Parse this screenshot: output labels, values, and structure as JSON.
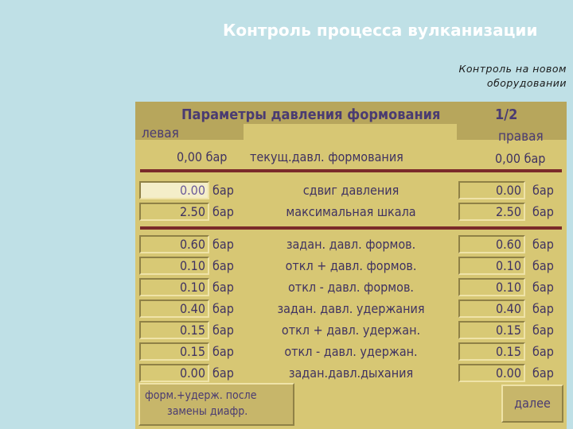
{
  "slide": {
    "title": "Контроль процесса вулканизации",
    "subtitle_line1": "Контроль на новом",
    "subtitle_line2": "оборудовании"
  },
  "screen": {
    "title": "Параметры давления формования",
    "page": "1/2",
    "left_label": "левая",
    "right_label": "правая",
    "current": {
      "left": "0,00 бар",
      "label": "текущ.давл. формования",
      "right": "0,00 бар"
    },
    "unit": "бар",
    "rows": [
      {
        "left": "0.00",
        "label": "сдвиг давления",
        "right": "0.00"
      },
      {
        "left": "2.50",
        "label": "максимальная шкала",
        "right": "2.50"
      },
      {
        "left": "0.60",
        "label": "задан. давл. формов.",
        "right": "0.60"
      },
      {
        "left": "0.10",
        "label": "откл + давл. формов.",
        "right": "0.10"
      },
      {
        "left": "0.10",
        "label": "откл - давл. формов.",
        "right": "0.10"
      },
      {
        "left": "0.40",
        "label": "задан. давл. удержания",
        "right": "0.40"
      },
      {
        "left": "0.15",
        "label": "откл + давл. удержан.",
        "right": "0.15"
      },
      {
        "left": "0.15",
        "label": "откл - давл. удержан.",
        "right": "0.15"
      },
      {
        "left": "0.00",
        "label": "задан.давл.дыхания",
        "right": "0.00"
      }
    ],
    "btn_form_line1": "форм.+удерж. после",
    "btn_form_line2": "замены диафр.",
    "btn_next": "далее"
  }
}
